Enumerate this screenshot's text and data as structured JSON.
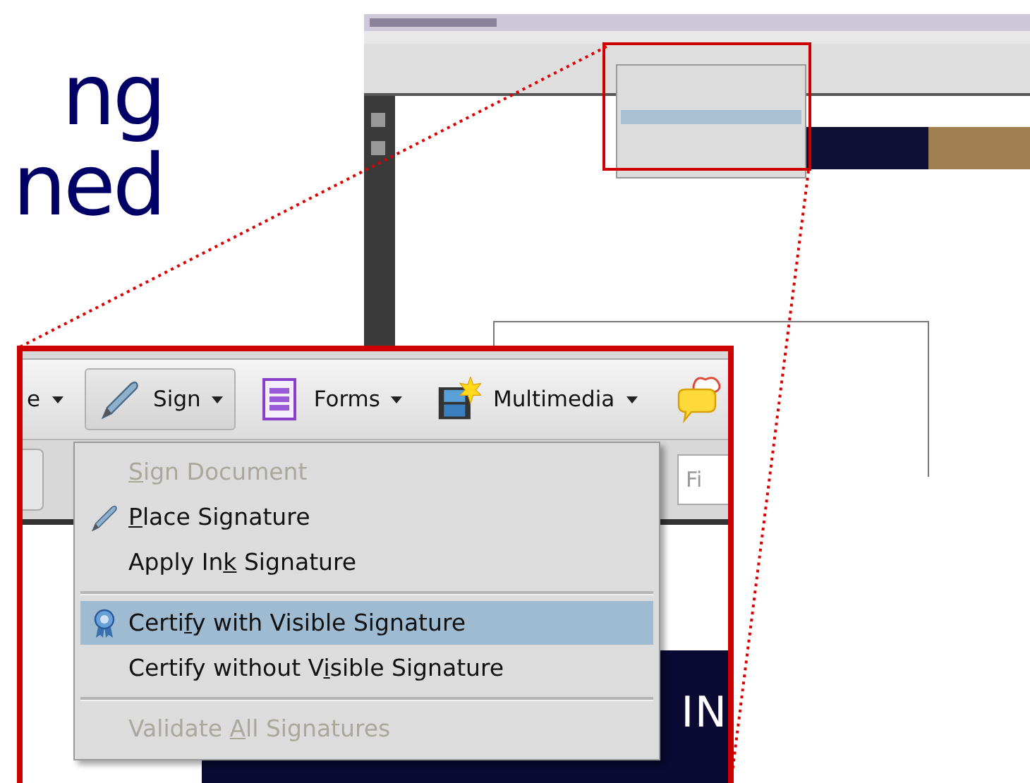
{
  "slide": {
    "title_lines": [
      "ng",
      "ned"
    ]
  },
  "toolbar": [
    {
      "label": "e",
      "selected": false
    },
    {
      "label": "Sign",
      "selected": true
    },
    {
      "label": "Forms",
      "selected": false
    },
    {
      "label": "Multimedia",
      "selected": false
    }
  ],
  "find_field": {
    "value": "Fi"
  },
  "document": {
    "banner_text": "IN"
  },
  "menu": [
    {
      "kind": "item",
      "key": "S",
      "after": "ign Document",
      "disabled": true,
      "selected": false
    },
    {
      "kind": "item",
      "key": "P",
      "after": "lace Signature",
      "disabled": false,
      "selected": false
    },
    {
      "kind": "item",
      "before": "Apply In",
      "key": "k",
      "after": " Signature",
      "disabled": false,
      "selected": false
    },
    {
      "kind": "separator"
    },
    {
      "kind": "item",
      "before": "Certi",
      "key": "f",
      "after": "y with Visible Signature",
      "disabled": false,
      "selected": true
    },
    {
      "kind": "item",
      "before": "Certify without V",
      "key": "i",
      "after": "sible Signature",
      "disabled": false,
      "selected": false
    },
    {
      "kind": "separator"
    },
    {
      "kind": "item",
      "before": "Validate ",
      "key": "A",
      "after": "ll Signatures",
      "disabled": true,
      "selected": false
    }
  ]
}
